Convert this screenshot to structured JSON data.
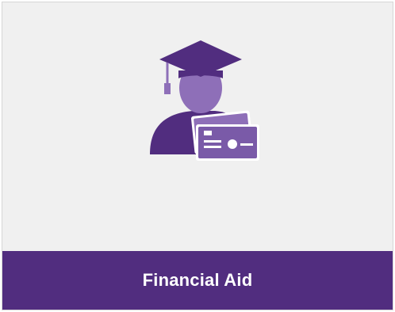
{
  "tile": {
    "label": "Financial Aid",
    "icon": "graduate-with-payment-card-icon"
  },
  "colors": {
    "tile_background": "#f0f0f0",
    "footer_background": "#512d7f",
    "label_text": "#ffffff",
    "icon_primary": "#512d7f",
    "icon_secondary": "#8e6fb8"
  }
}
